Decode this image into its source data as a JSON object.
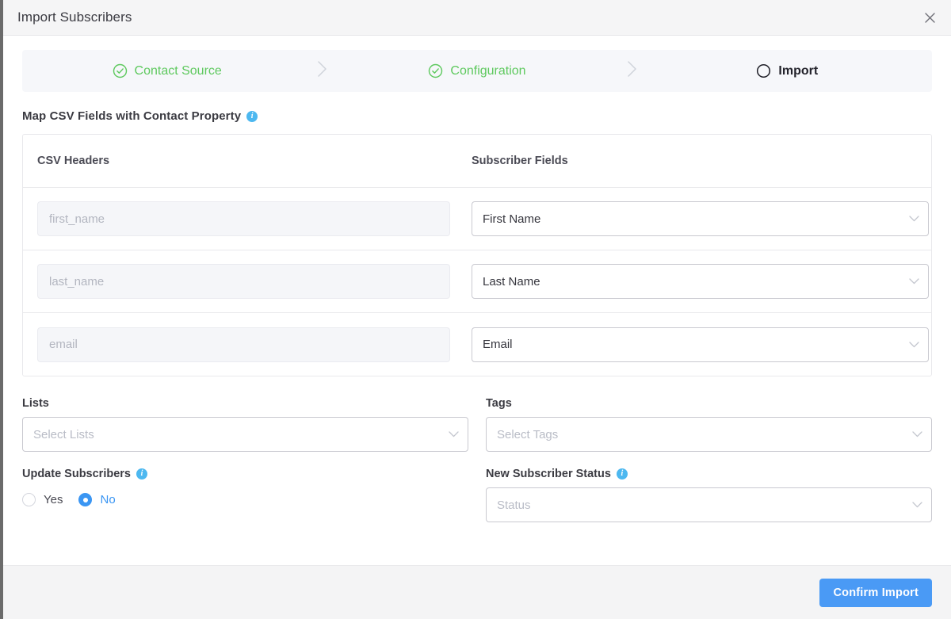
{
  "header": {
    "title": "Import Subscribers",
    "close_label": "×"
  },
  "stepper": {
    "steps": [
      {
        "label": "Contact Source",
        "state": "done",
        "icon": "check-circle-icon"
      },
      {
        "label": "Configuration",
        "state": "done",
        "icon": "check-circle-icon"
      },
      {
        "label": "Import",
        "state": "current",
        "icon": "empty-circle-icon"
      }
    ],
    "separator_icon": "chevron-right-icon"
  },
  "mapping_section": {
    "title": "Map CSV Fields with Contact Property",
    "info_icon": "info-icon",
    "info_glyph": "i",
    "columns": {
      "left": "CSV Headers",
      "right": "Subscriber Fields"
    },
    "rows": [
      {
        "csv_header": "first_name",
        "subscriber_field": "First Name"
      },
      {
        "csv_header": "last_name",
        "subscriber_field": "Last Name"
      },
      {
        "csv_header": "email",
        "subscriber_field": "Email"
      }
    ]
  },
  "lists_field": {
    "label": "Lists",
    "placeholder": "Select Lists",
    "value": ""
  },
  "tags_field": {
    "label": "Tags",
    "placeholder": "Select Tags",
    "value": ""
  },
  "update_subscribers": {
    "label": "Update Subscribers",
    "info_glyph": "i",
    "options": [
      {
        "label": "Yes",
        "selected": false
      },
      {
        "label": "No",
        "selected": true
      }
    ]
  },
  "new_subscriber_status": {
    "label": "New Subscriber Status",
    "info_glyph": "i",
    "placeholder": "Status",
    "value": ""
  },
  "footer": {
    "confirm_label": "Confirm Import"
  },
  "colors": {
    "accent_blue": "#4a9af5",
    "step_done_green": "#5ec95e",
    "info_blue": "#4db8f0",
    "header_bg": "#f5f5f6",
    "stepper_bg": "#f6f7fa",
    "footer_bg": "#f4f4f5"
  }
}
